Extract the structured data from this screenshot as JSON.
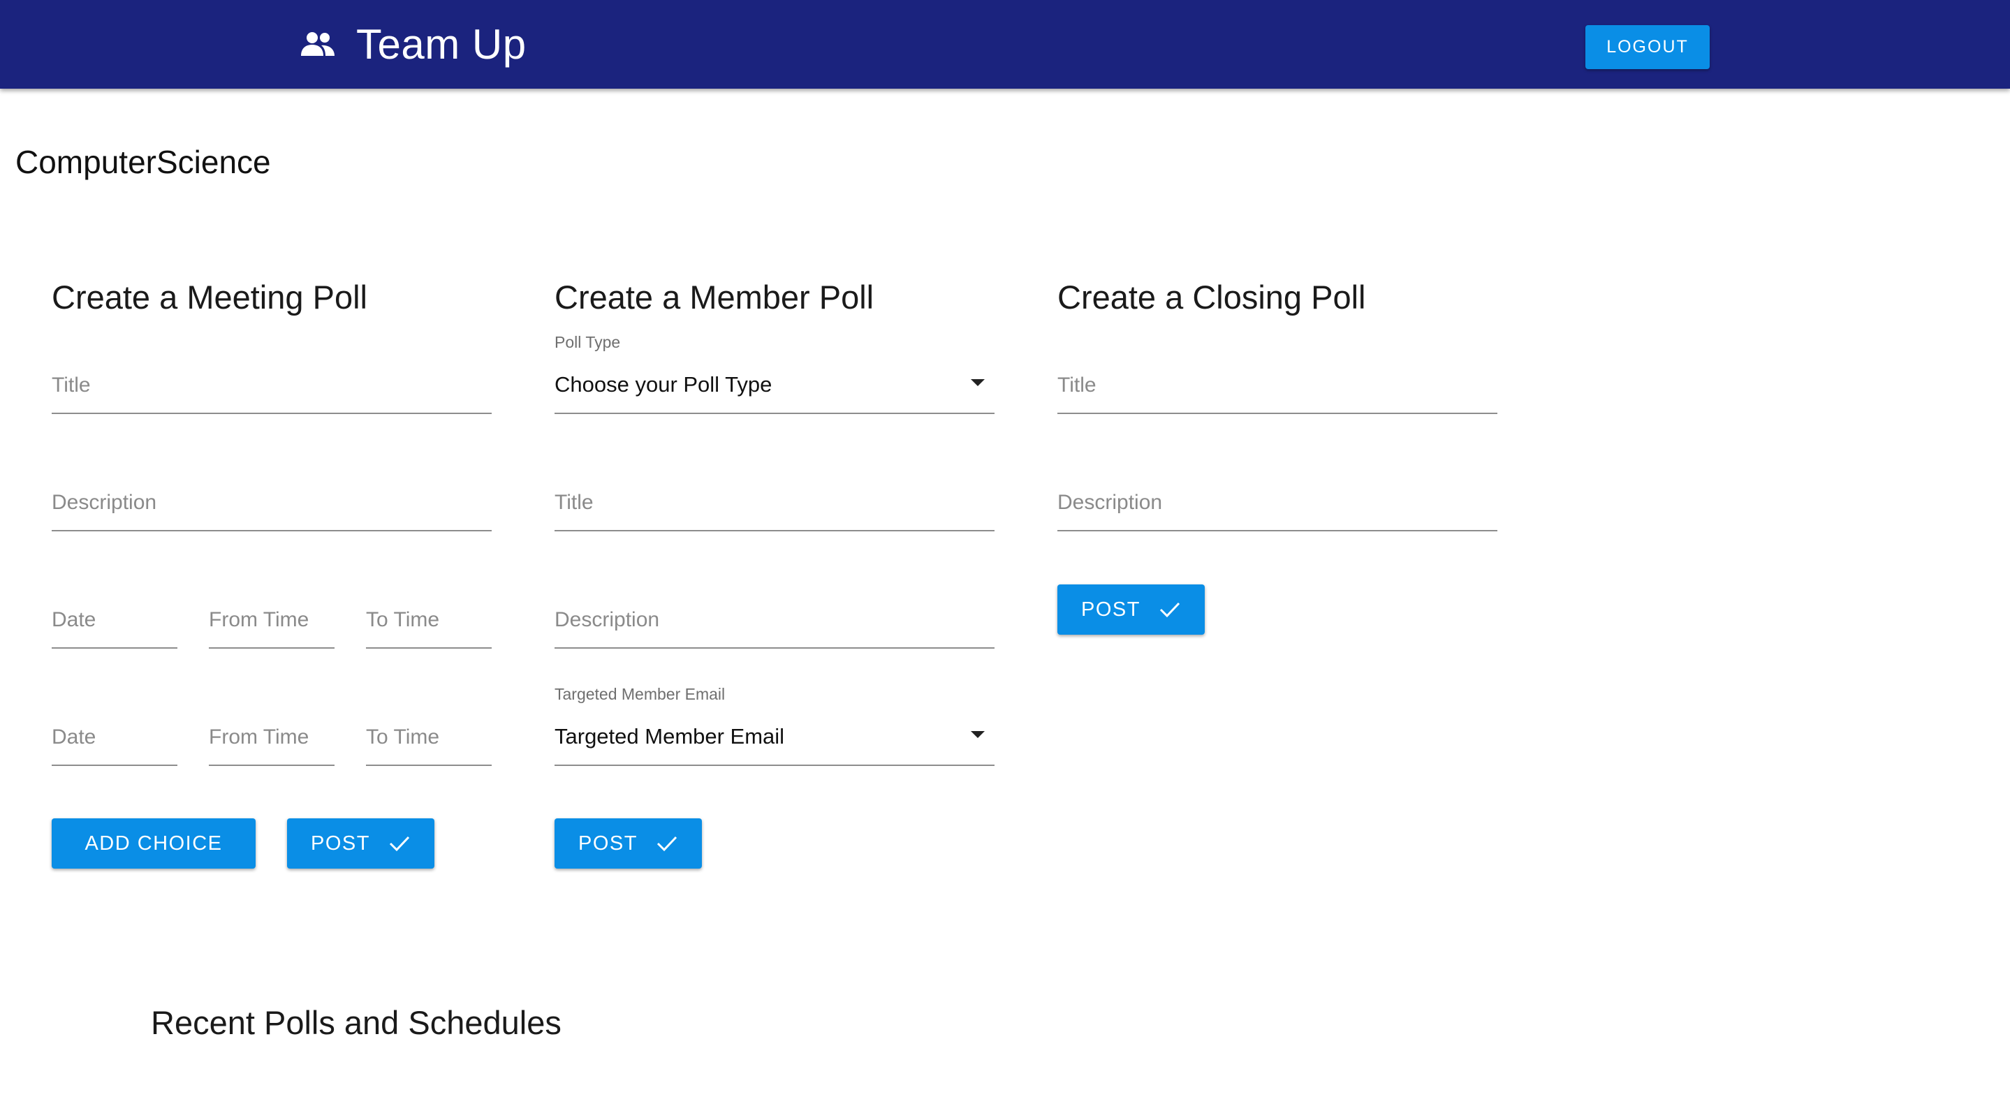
{
  "appbar": {
    "title": "Team Up",
    "logo_icon": "group-icon",
    "logout_label": "LOGOUT",
    "background": "#1b237e"
  },
  "group_name": "ComputerScience",
  "meeting_poll": {
    "title": "Create a Meeting Poll",
    "title_placeholder": "Title",
    "description_placeholder": "Description",
    "choices": [
      {
        "date": "Date",
        "from": "From Time",
        "to": "To Time"
      },
      {
        "date": "Date",
        "from": "From Time",
        "to": "To Time"
      }
    ],
    "add_choice_label": "ADD CHOICE",
    "post_label": "POST"
  },
  "member_poll": {
    "title": "Create a Member Poll",
    "poll_type_label": "Poll Type",
    "poll_type_value": "Choose your Poll Type",
    "title_placeholder": "Title",
    "description_placeholder": "Description",
    "target_label": "Targeted Member Email",
    "target_value": "Targeted Member Email",
    "post_label": "POST"
  },
  "closing_poll": {
    "title": "Create a Closing Poll",
    "title_placeholder": "Title",
    "description_placeholder": "Description",
    "post_label": "POST"
  },
  "recent": {
    "title": "Recent Polls and Schedules"
  },
  "colors": {
    "primary_button": "#0a8ee6",
    "underline": "#8d8d8d"
  }
}
